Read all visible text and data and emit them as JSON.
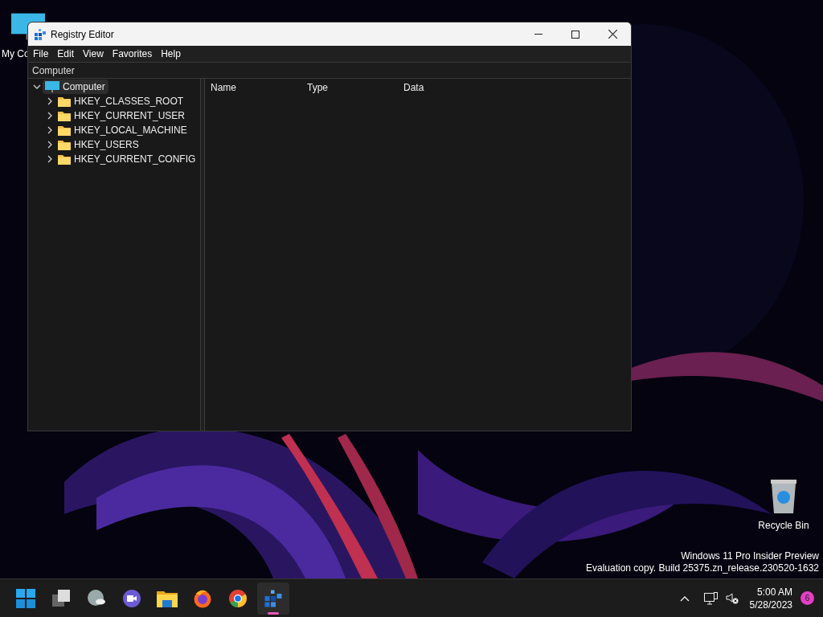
{
  "desktop_icons": [
    {
      "kind": "computer",
      "label": "My Co"
    },
    {
      "kind": "recycle",
      "label": "Recycle Bin"
    }
  ],
  "window": {
    "title": "Registry Editor",
    "menu": [
      "File",
      "Edit",
      "View",
      "Favorites",
      "Help"
    ],
    "address": "Computer",
    "tree": [
      {
        "label": "Computer",
        "kind": "computer",
        "expanded": true,
        "selected": true,
        "children": [
          {
            "label": "HKEY_CLASSES_ROOT",
            "kind": "folder",
            "expanded": false,
            "selected": false
          },
          {
            "label": "HKEY_CURRENT_USER",
            "kind": "folder",
            "expanded": false,
            "selected": false
          },
          {
            "label": "HKEY_LOCAL_MACHINE",
            "kind": "folder",
            "expanded": false,
            "selected": false
          },
          {
            "label": "HKEY_USERS",
            "kind": "folder",
            "expanded": false,
            "selected": false
          },
          {
            "label": "HKEY_CURRENT_CONFIG",
            "kind": "folder",
            "expanded": false,
            "selected": false
          }
        ]
      }
    ],
    "columns": [
      "Name",
      "Type",
      "Data"
    ]
  },
  "watermark": [
    "Windows 11 Pro Insider Preview",
    "Evaluation copy. Build 25375.zn_release.230520-1632"
  ],
  "taskbar": {
    "apps": [
      {
        "kind": "start",
        "selected": false
      },
      {
        "kind": "taskview",
        "selected": false
      },
      {
        "kind": "weather",
        "selected": false
      },
      {
        "kind": "chat",
        "selected": false
      },
      {
        "kind": "explorer",
        "selected": false
      },
      {
        "kind": "firefox",
        "selected": false
      },
      {
        "kind": "chrome",
        "selected": false
      },
      {
        "kind": "regedit",
        "selected": true
      }
    ],
    "time": "5:00 AM",
    "date": "5/28/2023",
    "notifications": "6"
  }
}
